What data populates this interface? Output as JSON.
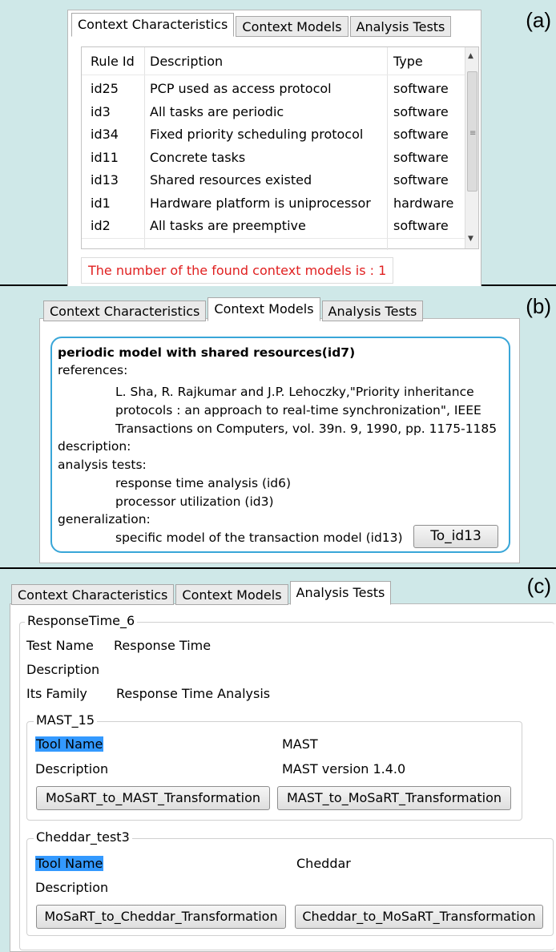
{
  "panel_a": {
    "label": "(a)",
    "tabs": [
      "Context Characteristics",
      "Context Models",
      "Analysis Tests"
    ],
    "columns": [
      "Rule Id",
      "Description",
      "Type"
    ],
    "rows": [
      {
        "id": "id25",
        "desc": "PCP used as access protocol",
        "type": "software"
      },
      {
        "id": "id3",
        "desc": "All tasks are periodic",
        "type": "software"
      },
      {
        "id": "id34",
        "desc": "Fixed priority scheduling protocol",
        "type": "software"
      },
      {
        "id": "id11",
        "desc": "Concrete tasks",
        "type": "software"
      },
      {
        "id": "id13",
        "desc": "Shared resources existed",
        "type": "software"
      },
      {
        "id": "id1",
        "desc": "Hardware platform is uniprocessor",
        "type": "hardware"
      },
      {
        "id": "id2",
        "desc": "All tasks are preemptive",
        "type": "software"
      }
    ],
    "status": "The number of the found context models is : 1"
  },
  "panel_b": {
    "label": "(b)",
    "tabs": [
      "Context Characteristics",
      "Context Models",
      "Analysis Tests"
    ],
    "title": "periodic model with shared resources(id7)",
    "references_label": "references:",
    "references": [
      "L. Sha, R. Rajkumar and J.P. Lehoczky,\"Priority inheritance",
      "protocols : an approach to real-time synchronization\", IEEE",
      "Transactions on Computers, vol. 39n. 9, 1990, pp. 1175-1185"
    ],
    "description_label": "description:",
    "analysis_tests_label": "analysis tests:",
    "analysis_tests": [
      "response time analysis (id6)",
      "processor utilization (id3)"
    ],
    "generalization_label": "generalization:",
    "generalization": "specific model of the transaction model (id13)",
    "button": "To_id13"
  },
  "panel_c": {
    "label": "(c)",
    "tabs": [
      "Context Characteristics",
      "Context Models",
      "Analysis Tests"
    ],
    "group_title": "ResponseTime_6",
    "test_name_label": "Test Name",
    "test_name_value": "Response Time",
    "description_label": "Description",
    "family_label": "Its Family",
    "family_value": "Response Time Analysis",
    "tools": [
      {
        "title": "MAST_15",
        "tool_name_label": "Tool Name",
        "tool_name_value": "MAST",
        "description_label": "Description",
        "description_value": "MAST version 1.4.0",
        "btn_to": "MoSaRT_to_MAST_Transformation",
        "btn_from": "MAST_to_MoSaRT_Transformation"
      },
      {
        "title": "Cheddar_test3",
        "tool_name_label": "Tool Name",
        "tool_name_value": "Cheddar",
        "description_label": "Description",
        "btn_to": "MoSaRT_to_Cheddar_Transformation",
        "btn_from": "Cheddar_to_MoSaRT_Transformation"
      }
    ]
  }
}
